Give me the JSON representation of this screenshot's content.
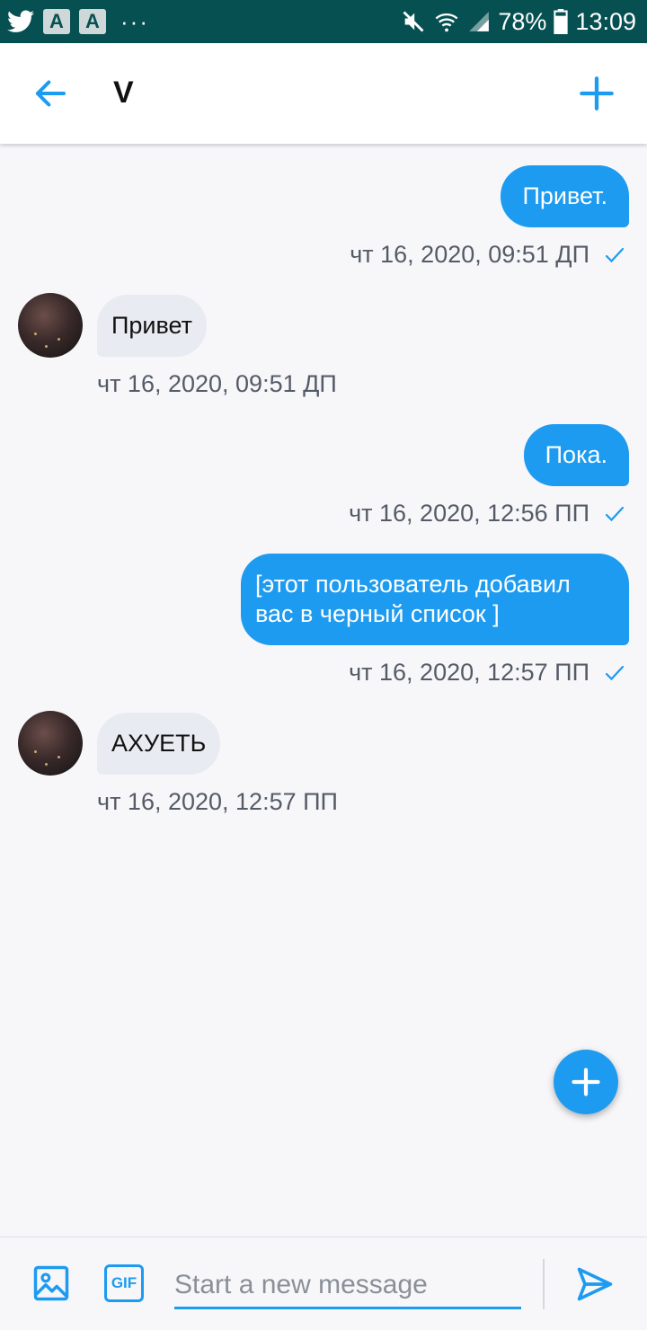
{
  "status_bar": {
    "battery": "78%",
    "time": "13:09",
    "left_icons": [
      "twitter-icon",
      "a-app-icon",
      "a-app-icon",
      "more-icon"
    ],
    "right_icons": [
      "mute-icon",
      "wifi-icon",
      "signal-icon",
      "battery-icon"
    ],
    "more_dots": "···"
  },
  "header": {
    "title": "V",
    "back_icon": "arrow-left-icon",
    "add_icon": "plus-icon"
  },
  "messages": [
    {
      "direction": "outgoing",
      "text": "Привет.",
      "timestamp": "чт 16, 2020, 09:51 ДП",
      "read": true
    },
    {
      "direction": "incoming",
      "text": "Привет",
      "timestamp": "чт 16, 2020, 09:51 ДП"
    },
    {
      "direction": "outgoing",
      "text": "Пока.",
      "timestamp": "чт 16, 2020, 12:56 ПП",
      "read": true
    },
    {
      "direction": "outgoing",
      "text": "[этот пользователь добавил вас в черный список ]",
      "timestamp": "чт 16, 2020, 12:57 ПП",
      "read": true
    },
    {
      "direction": "incoming",
      "text": "АХУЕТЬ",
      "timestamp": "чт 16, 2020, 12:57 ПП"
    }
  ],
  "composer": {
    "placeholder": "Start a new message",
    "gif_label": "GIF",
    "image_icon": "image-icon",
    "send_icon": "send-icon"
  },
  "colors": {
    "accent": "#1d9bf0",
    "status_bar": "#075052",
    "incoming_bubble": "#e9ebf2",
    "background": "#f7f7fa"
  }
}
